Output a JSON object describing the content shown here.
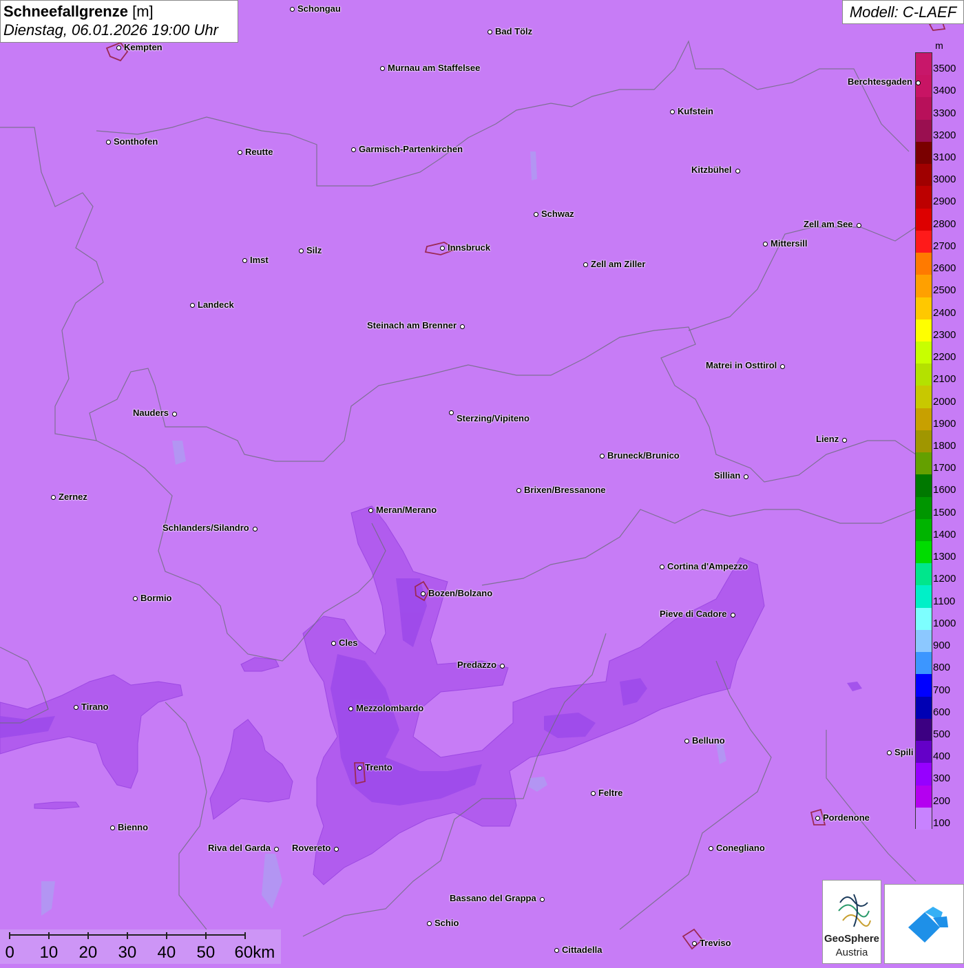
{
  "title": {
    "main": "Schneefallgrenze",
    "unit": "[m]",
    "date": "Dienstag, 06.01.2026 19:00 Uhr"
  },
  "model": "Modell: C-LAEF",
  "legend": {
    "unit": "m",
    "levels": [
      {
        "label": "3500",
        "color": "#c8176a"
      },
      {
        "label": "3400",
        "color": "#c81464"
      },
      {
        "label": "3300",
        "color": "#b8105a"
      },
      {
        "label": "3200",
        "color": "#9a0f50"
      },
      {
        "label": "3100",
        "color": "#7a0000"
      },
      {
        "label": "3000",
        "color": "#a00000"
      },
      {
        "label": "2900",
        "color": "#bd0000"
      },
      {
        "label": "2800",
        "color": "#dd0000"
      },
      {
        "label": "2700",
        "color": "#ff1a1a"
      },
      {
        "label": "2600",
        "color": "#ff7a00"
      },
      {
        "label": "2500",
        "color": "#ffa000"
      },
      {
        "label": "2400",
        "color": "#ffc800"
      },
      {
        "label": "2300",
        "color": "#ffff00"
      },
      {
        "label": "2200",
        "color": "#c8ff00"
      },
      {
        "label": "2100",
        "color": "#b4e100"
      },
      {
        "label": "2000",
        "color": "#c8c800"
      },
      {
        "label": "1900",
        "color": "#c8a000"
      },
      {
        "label": "1800",
        "color": "#a09600"
      },
      {
        "label": "1700",
        "color": "#64a000"
      },
      {
        "label": "1600",
        "color": "#007800"
      },
      {
        "label": "1500",
        "color": "#009600"
      },
      {
        "label": "1400",
        "color": "#00b400"
      },
      {
        "label": "1300",
        "color": "#00dc00"
      },
      {
        "label": "1200",
        "color": "#00e68c"
      },
      {
        "label": "1100",
        "color": "#00f0c8"
      },
      {
        "label": "1000",
        "color": "#7dffff"
      },
      {
        "label": "900",
        "color": "#8cc8ff"
      },
      {
        "label": "800",
        "color": "#3c96ff"
      },
      {
        "label": "700",
        "color": "#0000ff"
      },
      {
        "label": "600",
        "color": "#0000b4"
      },
      {
        "label": "500",
        "color": "#3c0082"
      },
      {
        "label": "400",
        "color": "#6400c8"
      },
      {
        "label": "300",
        "color": "#9600ff"
      },
      {
        "label": "200",
        "color": "#b400f0"
      },
      {
        "label": "100",
        "color": "#c882ff"
      }
    ]
  },
  "cities": [
    {
      "name": "Schongau"
    },
    {
      "name": "Bad Tölz"
    },
    {
      "name": "Kempten"
    },
    {
      "name": "Murnau am Staffelsee"
    },
    {
      "name": "Berchtesgaden"
    },
    {
      "name": "Kufstein"
    },
    {
      "name": "Sonthofen"
    },
    {
      "name": "Reutte"
    },
    {
      "name": "Garmisch-Partenkirchen"
    },
    {
      "name": "Kitzbühel"
    },
    {
      "name": "Schwaz"
    },
    {
      "name": "Zell am See"
    },
    {
      "name": "Innsbruck"
    },
    {
      "name": "Mittersill"
    },
    {
      "name": "Imst"
    },
    {
      "name": "Silz"
    },
    {
      "name": "Zell am Ziller"
    },
    {
      "name": "Landeck"
    },
    {
      "name": "Steinach am Brenner"
    },
    {
      "name": "Matrei in Osttirol"
    },
    {
      "name": "Nauders"
    },
    {
      "name": "Sterzing/Vipiteno"
    },
    {
      "name": "Lienz"
    },
    {
      "name": "Bruneck/Brunico"
    },
    {
      "name": "Sillian"
    },
    {
      "name": "Zernez"
    },
    {
      "name": "Brixen/Bressanone"
    },
    {
      "name": "Meran/Merano"
    },
    {
      "name": "Schlanders/Silandro"
    },
    {
      "name": "Cortina d'Ampezzo"
    },
    {
      "name": "Bormio"
    },
    {
      "name": "Bozen/Bolzano"
    },
    {
      "name": "Pieve di Cadore"
    },
    {
      "name": "Cles"
    },
    {
      "name": "Predazzo"
    },
    {
      "name": "Tirano"
    },
    {
      "name": "Mezzolombardo"
    },
    {
      "name": "Belluno"
    },
    {
      "name": "Spili"
    },
    {
      "name": "Trento"
    },
    {
      "name": "Feltre"
    },
    {
      "name": "Bienno"
    },
    {
      "name": "Pordenone"
    },
    {
      "name": "Riva del Garda"
    },
    {
      "name": "Rovereto"
    },
    {
      "name": "Conegliano"
    },
    {
      "name": "Bassano del Grappa"
    },
    {
      "name": "Schio"
    },
    {
      "name": "Treviso"
    },
    {
      "name": "Cittadella"
    }
  ],
  "scale": {
    "labels": [
      "0",
      "10",
      "20",
      "30",
      "40",
      "50",
      "60km"
    ]
  },
  "logos": {
    "geosphere_line1": "GeoSphere",
    "geosphere_line2": "Austria"
  },
  "colors": {
    "background": "#c77cf6",
    "snowline_low": "#b45ef0",
    "snowline_lower": "#9a45ea",
    "snowline_lowest": "#8a38e0"
  }
}
